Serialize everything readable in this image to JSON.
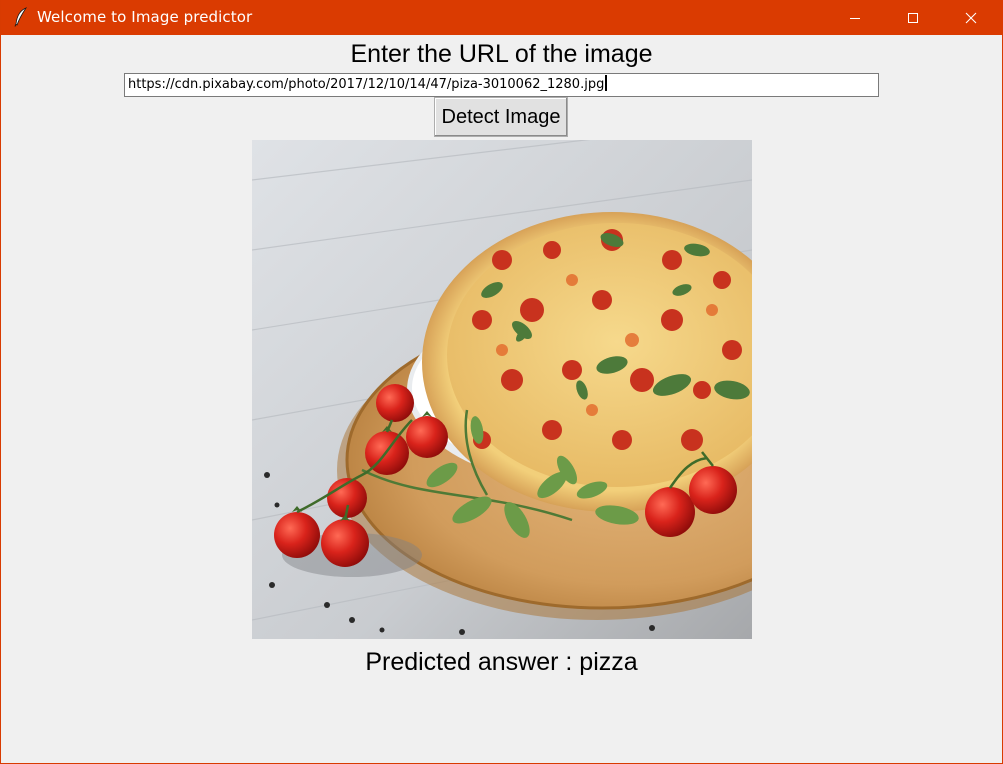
{
  "window": {
    "title": "Welcome to Image predictor",
    "titlebar_color": "#da3b01",
    "icons": [
      "feather-icon",
      "minimize-icon",
      "maximize-icon",
      "close-icon"
    ]
  },
  "main": {
    "heading": "Enter the URL of the image",
    "url_value": "https://cdn.pixabay.com/photo/2017/12/10/14/47/piza-3010062_1280.jpg",
    "detect_button_label": "Detect Image",
    "result_text": "Predicted answer : pizza"
  }
}
